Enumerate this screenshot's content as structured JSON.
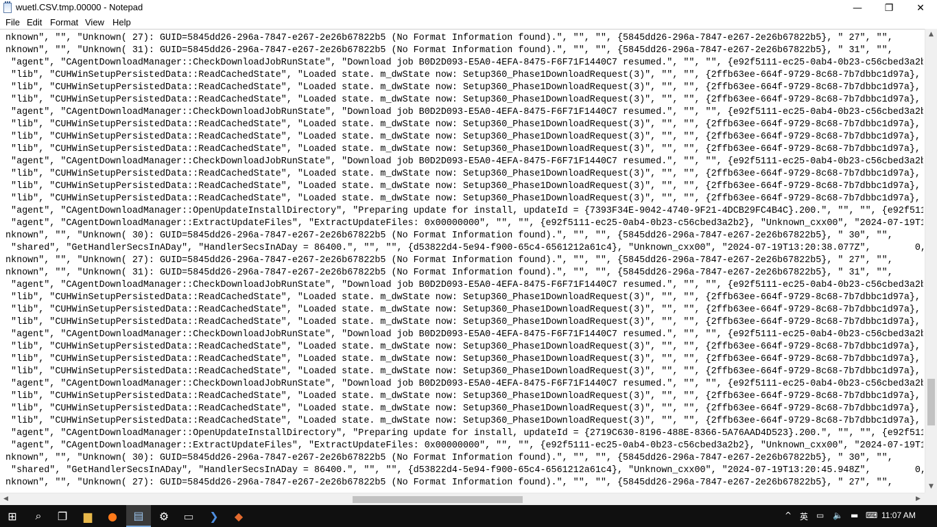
{
  "window": {
    "title": "wuetl.CSV.tmp.00000 - Notepad",
    "minimize_glyph": "—",
    "maximize_glyph": "❐",
    "close_glyph": "✕"
  },
  "menu": [
    "File",
    "Edit",
    "Format",
    "View",
    "Help"
  ],
  "lines": [
    "nknown\", \"\", \"Unknown( 27): GUID=5845dd26-296a-7847-e267-2e26b67822b5 (No Format Information found).\", \"\", \"\", {5845dd26-296a-7847-e267-2e26b67822b5}, \" 27\", \"\",",
    "nknown\", \"\", \"Unknown( 31): GUID=5845dd26-296a-7847-e267-2e26b67822b5 (No Format Information found).\", \"\", \"\", {5845dd26-296a-7847-e267-2e26b67822b5}, \" 31\", \"\",",
    " \"agent\", \"CAgentDownloadManager::CheckDownloadJobRunState\", \"Download job B0D2D093-E5A0-4EFA-8475-F6F71F1440C7 resumed.\", \"\", \"\", {e92f5111-ec25-0ab4-0b23-c56cbed3a2b",
    " \"lib\", \"CUHWinSetupPersistedData::ReadCachedState\", \"Loaded state. m_dwState now: Setup360_Phase1DownloadRequest(3)\", \"\", \"\", {2ffb63ee-664f-9729-8c68-7b7dbbc1d97a},",
    " \"lib\", \"CUHWinSetupPersistedData::ReadCachedState\", \"Loaded state. m_dwState now: Setup360_Phase1DownloadRequest(3)\", \"\", \"\", {2ffb63ee-664f-9729-8c68-7b7dbbc1d97a},",
    " \"lib\", \"CUHWinSetupPersistedData::ReadCachedState\", \"Loaded state. m_dwState now: Setup360_Phase1DownloadRequest(3)\", \"\", \"\", {2ffb63ee-664f-9729-8c68-7b7dbbc1d97a},",
    " \"agent\", \"CAgentDownloadManager::CheckDownloadJobRunState\", \"Download job B0D2D093-E5A0-4EFA-8475-F6F71F1440C7 resumed.\", \"\", \"\", {e92f5111-ec25-0ab4-0b23-c56cbed3a2b",
    " \"lib\", \"CUHWinSetupPersistedData::ReadCachedState\", \"Loaded state. m_dwState now: Setup360_Phase1DownloadRequest(3)\", \"\", \"\", {2ffb63ee-664f-9729-8c68-7b7dbbc1d97a},",
    " \"lib\", \"CUHWinSetupPersistedData::ReadCachedState\", \"Loaded state. m_dwState now: Setup360_Phase1DownloadRequest(3)\", \"\", \"\", {2ffb63ee-664f-9729-8c68-7b7dbbc1d97a},",
    " \"lib\", \"CUHWinSetupPersistedData::ReadCachedState\", \"Loaded state. m_dwState now: Setup360_Phase1DownloadRequest(3)\", \"\", \"\", {2ffb63ee-664f-9729-8c68-7b7dbbc1d97a},",
    " \"agent\", \"CAgentDownloadManager::CheckDownloadJobRunState\", \"Download job B0D2D093-E5A0-4EFA-8475-F6F71F1440C7 resumed.\", \"\", \"\", {e92f5111-ec25-0ab4-0b23-c56cbed3a2b",
    " \"lib\", \"CUHWinSetupPersistedData::ReadCachedState\", \"Loaded state. m_dwState now: Setup360_Phase1DownloadRequest(3)\", \"\", \"\", {2ffb63ee-664f-9729-8c68-7b7dbbc1d97a},",
    " \"lib\", \"CUHWinSetupPersistedData::ReadCachedState\", \"Loaded state. m_dwState now: Setup360_Phase1DownloadRequest(3)\", \"\", \"\", {2ffb63ee-664f-9729-8c68-7b7dbbc1d97a},",
    " \"lib\", \"CUHWinSetupPersistedData::ReadCachedState\", \"Loaded state. m_dwState now: Setup360_Phase1DownloadRequest(3)\", \"\", \"\", {2ffb63ee-664f-9729-8c68-7b7dbbc1d97a},",
    " \"agent\", \"CAgentDownloadManager::OpenUpdateInstallDirectory\", \"Preparing update for install, updateId = {7393F34E-9042-4740-9F21-4DCB29FC4B4C}.200.\", \"\", \"\", {e92f511",
    " \"agent\", \"CAgentDownloadManager::ExtractUpdateFiles\", \"ExtractUpdateFiles: 0x00000000\", \"\", \"\", {e92f5111-ec25-0ab4-0b23-c56cbed3a2b2}, \"Unknown_cxx00\", \"2024-07-19T1",
    "nknown\", \"\", \"Unknown( 30): GUID=5845dd26-296a-7847-e267-2e26b67822b5 (No Format Information found).\", \"\", \"\", {5845dd26-296a-7847-e267-2e26b67822b5}, \" 30\", \"\",",
    " \"shared\", \"GetHandlerSecsInADay\", \"HandlerSecsInADay = 86400.\", \"\", \"\", {d53822d4-5e94-f900-65c4-6561212a61c4}, \"Unknown_cxx00\", \"2024-07-19T13:20:38.077Z\",        0,",
    "nknown\", \"\", \"Unknown( 27): GUID=5845dd26-296a-7847-e267-2e26b67822b5 (No Format Information found).\", \"\", \"\", {5845dd26-296a-7847-e267-2e26b67822b5}, \" 27\", \"\",",
    "nknown\", \"\", \"Unknown( 31): GUID=5845dd26-296a-7847-e267-2e26b67822b5 (No Format Information found).\", \"\", \"\", {5845dd26-296a-7847-e267-2e26b67822b5}, \" 31\", \"\",",
    " \"agent\", \"CAgentDownloadManager::CheckDownloadJobRunState\", \"Download job B0D2D093-E5A0-4EFA-8475-F6F71F1440C7 resumed.\", \"\", \"\", {e92f5111-ec25-0ab4-0b23-c56cbed3a2b",
    " \"lib\", \"CUHWinSetupPersistedData::ReadCachedState\", \"Loaded state. m_dwState now: Setup360_Phase1DownloadRequest(3)\", \"\", \"\", {2ffb63ee-664f-9729-8c68-7b7dbbc1d97a},",
    " \"lib\", \"CUHWinSetupPersistedData::ReadCachedState\", \"Loaded state. m_dwState now: Setup360_Phase1DownloadRequest(3)\", \"\", \"\", {2ffb63ee-664f-9729-8c68-7b7dbbc1d97a},",
    " \"lib\", \"CUHWinSetupPersistedData::ReadCachedState\", \"Loaded state. m_dwState now: Setup360_Phase1DownloadRequest(3)\", \"\", \"\", {2ffb63ee-664f-9729-8c68-7b7dbbc1d97a},",
    " \"agent\", \"CAgentDownloadManager::CheckDownloadJobRunState\", \"Download job B0D2D093-E5A0-4EFA-8475-F6F71F1440C7 resumed.\", \"\", \"\", {e92f5111-ec25-0ab4-0b23-c56cbed3a2b",
    " \"lib\", \"CUHWinSetupPersistedData::ReadCachedState\", \"Loaded state. m_dwState now: Setup360_Phase1DownloadRequest(3)\", \"\", \"\", {2ffb63ee-664f-9729-8c68-7b7dbbc1d97a},",
    " \"lib\", \"CUHWinSetupPersistedData::ReadCachedState\", \"Loaded state. m_dwState now: Setup360_Phase1DownloadRequest(3)\", \"\", \"\", {2ffb63ee-664f-9729-8c68-7b7dbbc1d97a},",
    " \"lib\", \"CUHWinSetupPersistedData::ReadCachedState\", \"Loaded state. m_dwState now: Setup360_Phase1DownloadRequest(3)\", \"\", \"\", {2ffb63ee-664f-9729-8c68-7b7dbbc1d97a},",
    " \"agent\", \"CAgentDownloadManager::CheckDownloadJobRunState\", \"Download job B0D2D093-E5A0-4EFA-8475-F6F71F1440C7 resumed.\", \"\", \"\", {e92f5111-ec25-0ab4-0b23-c56cbed3a2b",
    " \"lib\", \"CUHWinSetupPersistedData::ReadCachedState\", \"Loaded state. m_dwState now: Setup360_Phase1DownloadRequest(3)\", \"\", \"\", {2ffb63ee-664f-9729-8c68-7b7dbbc1d97a},",
    " \"lib\", \"CUHWinSetupPersistedData::ReadCachedState\", \"Loaded state. m_dwState now: Setup360_Phase1DownloadRequest(3)\", \"\", \"\", {2ffb63ee-664f-9729-8c68-7b7dbbc1d97a},",
    " \"lib\", \"CUHWinSetupPersistedData::ReadCachedState\", \"Loaded state. m_dwState now: Setup360_Phase1DownloadRequest(3)\", \"\", \"\", {2ffb63ee-664f-9729-8c68-7b7dbbc1d97a},",
    " \"agent\", \"CAgentDownloadManager::OpenUpdateInstallDirectory\", \"Preparing update for install, updateId = {2719C630-8196-488E-8366-5A76AAD4D523}.200.\", \"\", \"\", {e92f511",
    " \"agent\", \"CAgentDownloadManager::ExtractUpdateFiles\", \"ExtractUpdateFiles: 0x00000000\", \"\", \"\", {e92f5111-ec25-0ab4-0b23-c56cbed3a2b2}, \"Unknown_cxx00\", \"2024-07-19T1",
    "nknown\", \"\", \"Unknown( 30): GUID=5845dd26-296a-7847-e267-2e26b67822b5 (No Format Information found).\", \"\", \"\", {5845dd26-296a-7847-e267-2e26b67822b5}, \" 30\", \"\",",
    " \"shared\", \"GetHandlerSecsInADay\", \"HandlerSecsInADay = 86400.\", \"\", \"\", {d53822d4-5e94-f900-65c4-6561212a61c4}, \"Unknown_cxx00\", \"2024-07-19T13:20:45.948Z\",        0,",
    "nknown\", \"\", \"Unknown( 27): GUID=5845dd26-296a-7847-e267-2e26b67822b5 (No Format Information found).\", \"\", \"\", {5845dd26-296a-7847-e267-2e26b67822b5}, \" 27\", \"\","
  ],
  "scrollbars": {
    "up": "▲",
    "down": "▼",
    "left": "◀",
    "right": "▶"
  },
  "taskbar": {
    "items": [
      {
        "name": "start-button",
        "icon": "windows-logo-icon",
        "glyph": "⊞"
      },
      {
        "name": "search-button",
        "icon": "search-icon",
        "glyph": "⌕"
      },
      {
        "name": "task-view-button",
        "icon": "task-view-icon",
        "glyph": "❐"
      },
      {
        "name": "file-explorer-button",
        "icon": "folder-icon",
        "glyph": "▆"
      },
      {
        "name": "firefox-button",
        "icon": "firefox-icon",
        "glyph": "●"
      },
      {
        "name": "notepad-button",
        "icon": "notepad-icon",
        "glyph": "▤"
      },
      {
        "name": "settings-button",
        "icon": "gear-icon",
        "glyph": "⚙"
      },
      {
        "name": "cmd-button",
        "icon": "command-prompt-icon",
        "glyph": "▭"
      },
      {
        "name": "powershell-button",
        "icon": "powershell-icon",
        "glyph": "❯"
      },
      {
        "name": "app-button",
        "icon": "app-icon",
        "glyph": "◆"
      }
    ],
    "tray": {
      "chevron": "^",
      "ime": "英",
      "network": "▭",
      "volume": "🔈",
      "notification": "▬",
      "keyboard": "⌨"
    },
    "clock": "11:07 AM"
  }
}
